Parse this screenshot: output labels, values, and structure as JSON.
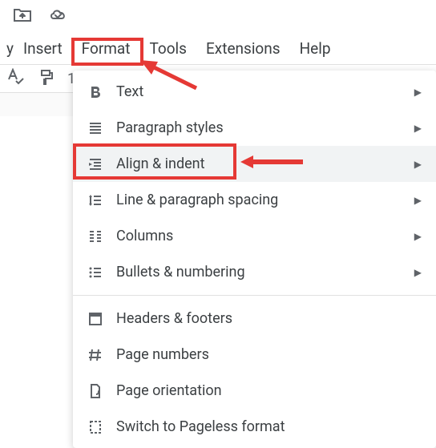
{
  "menubar": {
    "insert": "Insert",
    "format": "Format",
    "tools": "Tools",
    "extensions": "Extensions",
    "help": "Help"
  },
  "toolbar": {
    "partial_text": "1"
  },
  "dropdown": {
    "text": "Text",
    "paragraph_styles": "Paragraph styles",
    "align_indent": "Align & indent",
    "line_spacing": "Line & paragraph spacing",
    "columns": "Columns",
    "bullets_numbering": "Bullets & numbering",
    "headers_footers": "Headers & footers",
    "page_numbers": "Page numbers",
    "page_orientation": "Page orientation",
    "switch_pageless": "Switch to Pageless format"
  }
}
